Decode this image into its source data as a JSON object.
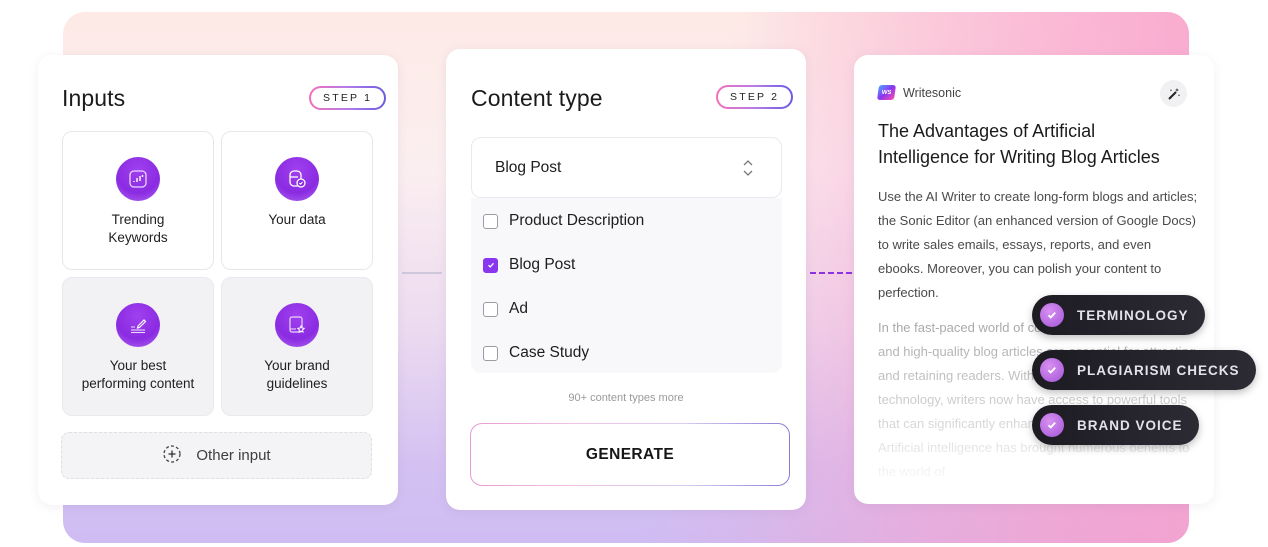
{
  "inputs_card": {
    "title": "Inputs",
    "step": "STEP 1",
    "tiles": [
      {
        "label_line1": "Trending",
        "label_line2": "Keywords",
        "icon": "bar-chart-icon"
      },
      {
        "label_line1": "Your data",
        "label_line2": "",
        "icon": "database-check-icon"
      },
      {
        "label_line1": "Your best",
        "label_line2": "performing content",
        "icon": "pencil-lines-icon"
      },
      {
        "label_line1": "Your brand",
        "label_line2": "guidelines",
        "icon": "book-star-icon"
      }
    ],
    "other_input": {
      "label": "Other input",
      "icon": "plus-circle-icon"
    }
  },
  "content_card": {
    "title": "Content type",
    "step": "STEP 2",
    "select": {
      "value": "Blog Post",
      "icon": "chevron-up-down-icon"
    },
    "options": [
      {
        "label": "Product Description",
        "checked": false
      },
      {
        "label": "Blog Post",
        "checked": true
      },
      {
        "label": "Ad",
        "checked": false
      },
      {
        "label": "Case Study",
        "checked": false
      }
    ],
    "more_text": "90+ content types more",
    "generate_label": "GENERATE"
  },
  "output_card": {
    "brand_name": "Writesonic",
    "brand_logo_text": "WS",
    "magic_icon": "magic-wand-icon",
    "title": "The Advantages of Artificial Intelligence for Writing Blog Articles",
    "paragraph1": "Use the AI Writer to create long-form blogs and articles; the Sonic Editor (an enhanced version of Google Docs) to write sales emails, essays, reports, and even ebooks. Moreover, you can polish your content to perfection.",
    "paragraph2": "In the fast-paced world of content creation, engaging and high-quality blog articles are essential for attracting and retaining readers. With the advancements in AI technology, writers now have access to powerful tools that can significantly enhance their writing process. Artificial intelligence has brought numerous benefits to the world of",
    "feature_pills": [
      "TERMINOLOGY",
      "PLAGIARISM CHECKS",
      "BRAND VOICE"
    ]
  },
  "colors": {
    "accent_purple": "#8a35f0",
    "pill_dark": "#1d1b22",
    "check_pink": "#c57ae8"
  }
}
